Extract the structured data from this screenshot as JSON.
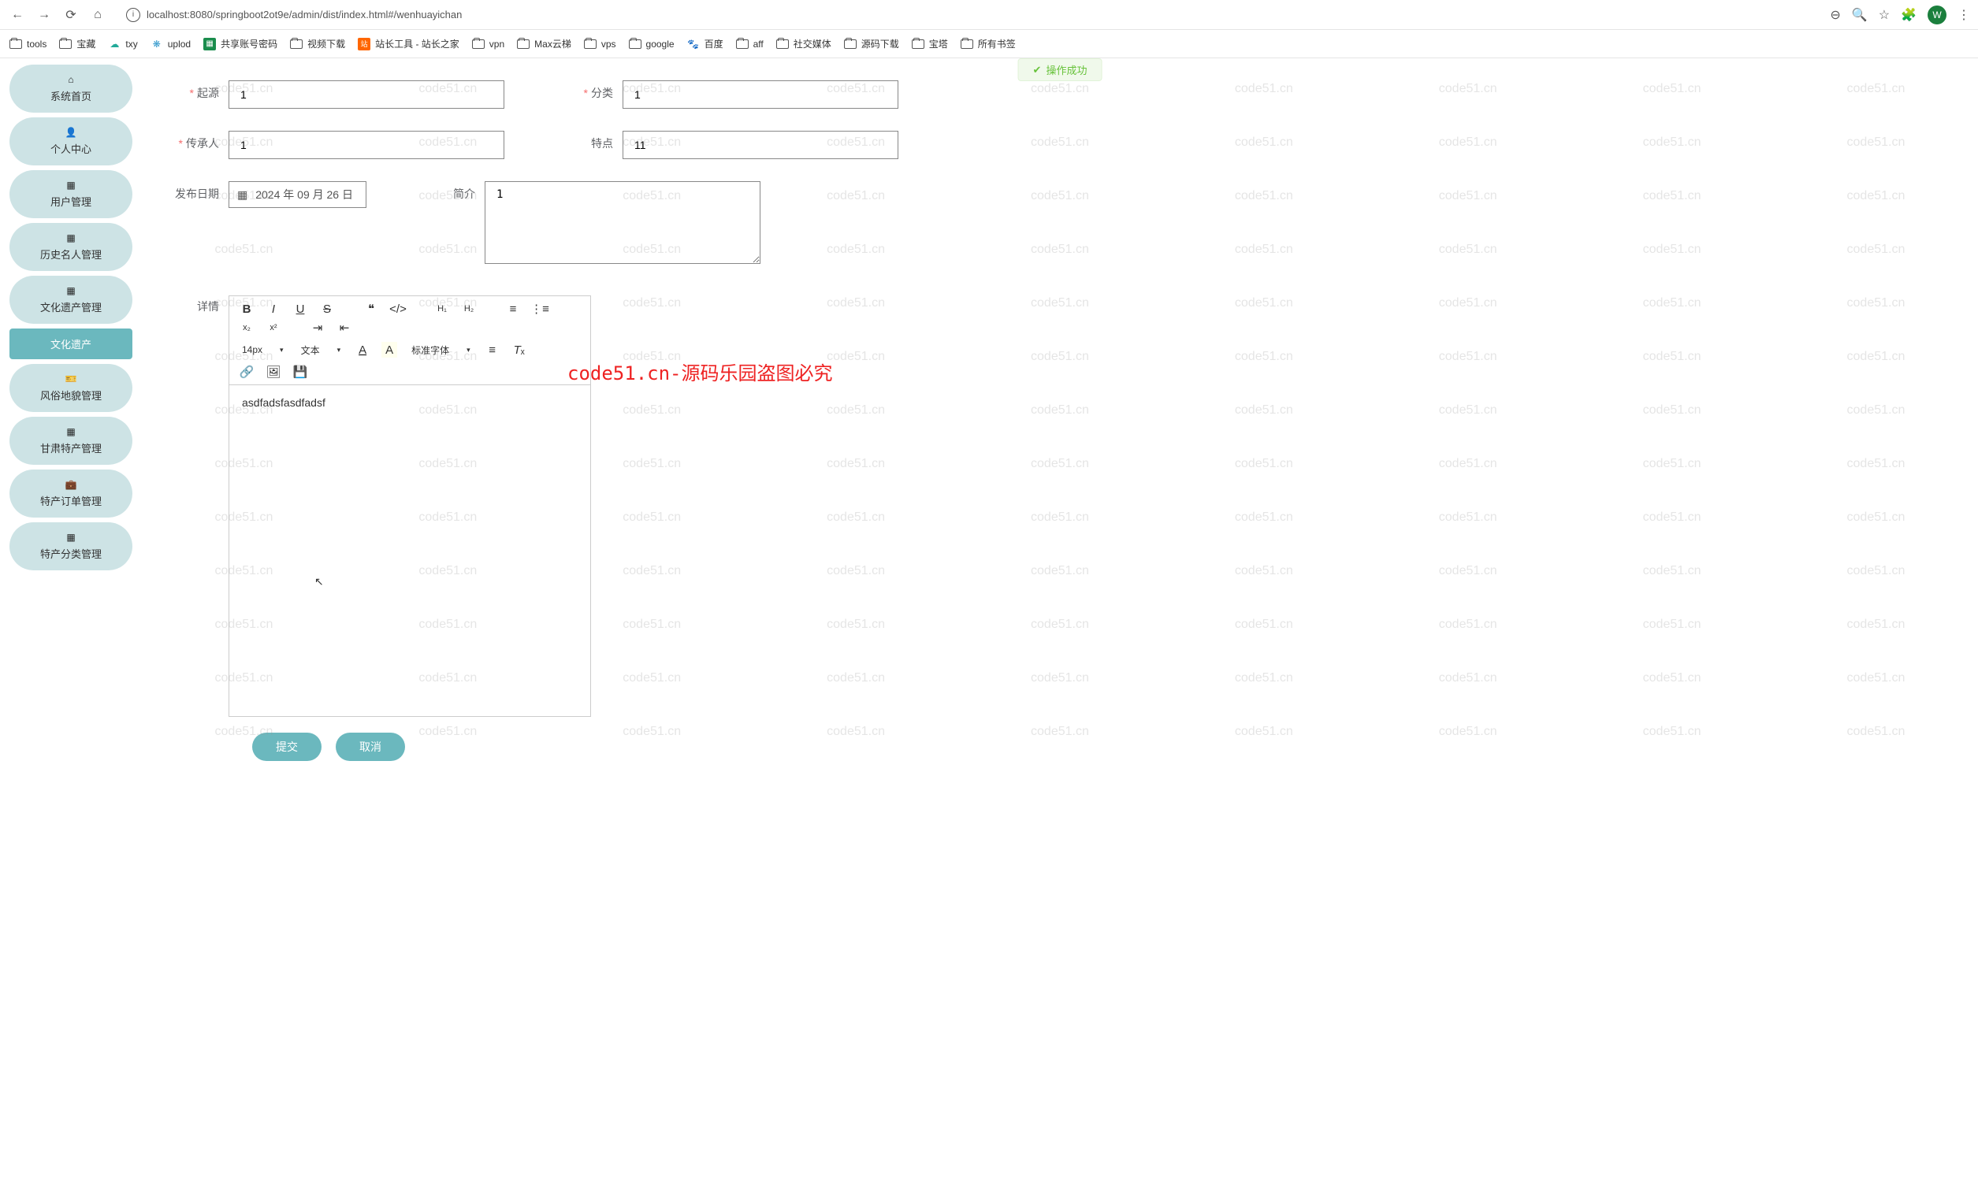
{
  "browser": {
    "url": "localhost:8080/springboot2ot9e/admin/dist/index.html#/wenhuayichan",
    "avatar_letter": "W"
  },
  "bookmarks": [
    {
      "label": "tools",
      "icon": "folder"
    },
    {
      "label": "宝藏",
      "icon": "folder"
    },
    {
      "label": "txy",
      "icon": "cloud"
    },
    {
      "label": "uplod",
      "icon": "sm"
    },
    {
      "label": "共享账号密码",
      "icon": "sheet"
    },
    {
      "label": "视频下载",
      "icon": "folder"
    },
    {
      "label": "站长工具 - 站长之家",
      "icon": "zz"
    },
    {
      "label": "vpn",
      "icon": "folder"
    },
    {
      "label": "Max云梯",
      "icon": "folder"
    },
    {
      "label": "vps",
      "icon": "folder"
    },
    {
      "label": "google",
      "icon": "folder"
    },
    {
      "label": "百度",
      "icon": "baidu"
    },
    {
      "label": "aff",
      "icon": "folder"
    },
    {
      "label": "社交媒体",
      "icon": "folder"
    },
    {
      "label": "源码下载",
      "icon": "folder"
    },
    {
      "label": "宝塔",
      "icon": "folder"
    },
    {
      "label": "所有书签",
      "icon": "folder"
    }
  ],
  "sidebar": [
    {
      "label": "系统首页",
      "icon": "home"
    },
    {
      "label": "个人中心",
      "icon": "user"
    },
    {
      "label": "用户管理",
      "icon": "grid"
    },
    {
      "label": "历史名人管理",
      "icon": "grid"
    },
    {
      "label": "文化遗产管理",
      "icon": "grid"
    },
    {
      "label": "文化遗产",
      "icon": "",
      "active": true
    },
    {
      "label": "风俗地貌管理",
      "icon": "ticket"
    },
    {
      "label": "甘肃特产管理",
      "icon": "grid"
    },
    {
      "label": "特产订单管理",
      "icon": "briefcase"
    },
    {
      "label": "特产分类管理",
      "icon": "grid"
    }
  ],
  "success_msg": "操作成功",
  "form": {
    "origin_label": "起源",
    "origin_value": "1",
    "category_label": "分类",
    "category_value": "1",
    "inheritor_label": "传承人",
    "inheritor_value": "1",
    "feature_label": "特点",
    "feature_value": "11",
    "pubdate_label": "发布日期",
    "pubdate_value": "2024 年 09 月 26 日",
    "intro_label": "简介",
    "intro_value": "1",
    "detail_label": "详情"
  },
  "editor": {
    "font_size": "14px",
    "text_label": "文本",
    "font_family": "标准字体",
    "content": "asdfadsfasdfadsf"
  },
  "buttons": {
    "submit": "提交",
    "cancel": "取消"
  },
  "watermark": "code51.cn",
  "center_watermark": "code51.cn-源码乐园盗图必究"
}
